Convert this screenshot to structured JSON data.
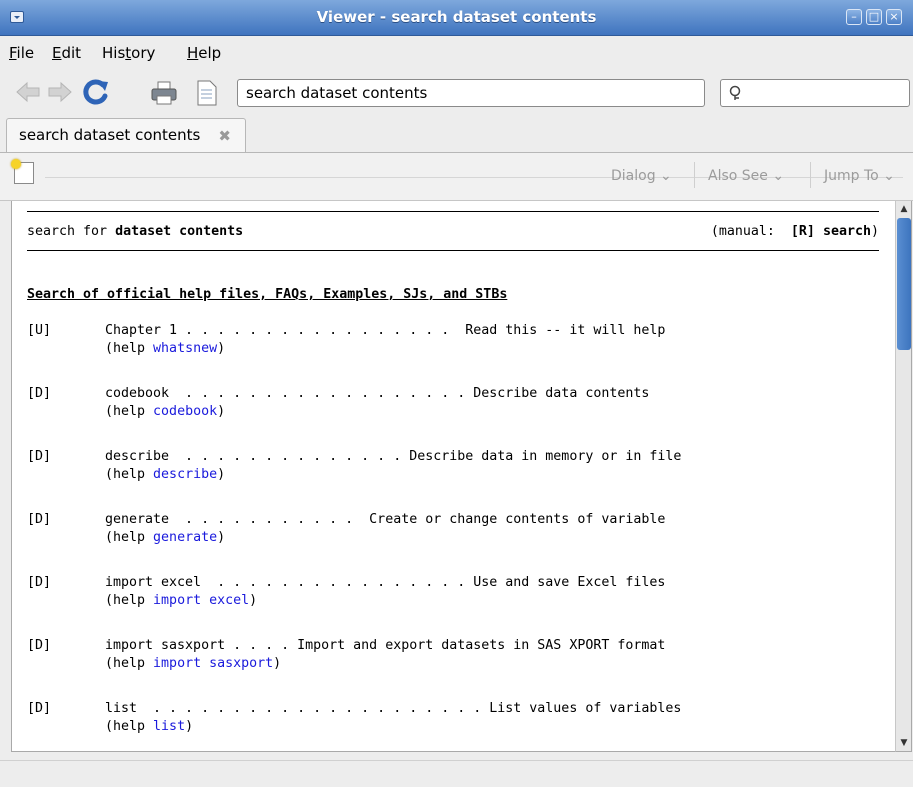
{
  "window": {
    "title": "Viewer - search dataset contents"
  },
  "menu": [
    {
      "label": "File",
      "mnemonic": "F",
      "rest": "ile"
    },
    {
      "label": "Edit",
      "mnemonic": "E",
      "rest": "dit"
    },
    {
      "label": "History",
      "pre": "His",
      "mnemonic": "t",
      "rest": "ory"
    },
    {
      "label": "Help",
      "mnemonic": "H",
      "rest": "elp"
    }
  ],
  "toolbar": {
    "address_value": "search dataset contents",
    "icons": [
      "back-arrow-icon",
      "forward-arrow-icon",
      "refresh-icon",
      "print-icon",
      "document-icon",
      "search-icon"
    ]
  },
  "tabs": [
    {
      "label": "search dataset contents"
    }
  ],
  "subtoolbar": {
    "dialog": "Dialog",
    "also_see": "Also See",
    "jump_to": "Jump To"
  },
  "colors": {
    "title_bar": "#3f74bf",
    "link": "#1a1adc",
    "scroll_thumb": "#4a82c8"
  },
  "content": {
    "header_prefix": "search for ",
    "header_term": "dataset contents",
    "manual_prefix": "(manual:  ",
    "manual_ref": "[R] search",
    "manual_suffix": ")",
    "section_title": "Search of official help files, FAQs, Examples, SJs, and STBs",
    "entries": [
      {
        "tag": "[U]",
        "line": "Chapter 1 . . . . . . . . . . . . . . . . .  Read this -- it will help",
        "help_prefix": "(help ",
        "help_link": "whatsnew",
        "help_suffix": ")"
      },
      {
        "tag": "[D]",
        "line": "codebook  . . . . . . . . . . . . . . . . . . Describe data contents",
        "help_prefix": "(help ",
        "help_link": "codebook",
        "help_suffix": ")"
      },
      {
        "tag": "[D]",
        "line": "describe  . . . . . . . . . . . . . . Describe data in memory or in file",
        "help_prefix": "(help ",
        "help_link": "describe",
        "help_suffix": ")"
      },
      {
        "tag": "[D]",
        "line": "generate  . . . . . . . . . . .  Create or change contents of variable",
        "help_prefix": "(help ",
        "help_link": "generate",
        "help_suffix": ")"
      },
      {
        "tag": "[D]",
        "line": "import excel  . . . . . . . . . . . . . . . . Use and save Excel files",
        "help_prefix": "(help ",
        "help_link": "import excel",
        "help_suffix": ")"
      },
      {
        "tag": "[D]",
        "line": "import sasxport . . . . Import and export datasets in SAS XPORT format",
        "help_prefix": "(help ",
        "help_link": "import sasxport",
        "help_suffix": ")"
      },
      {
        "tag": "[D]",
        "line": "list  . . . . . . . . . . . . . . . . . . . . . List values of variables",
        "help_prefix": "(help ",
        "help_link": "list",
        "help_suffix": ")"
      }
    ]
  }
}
